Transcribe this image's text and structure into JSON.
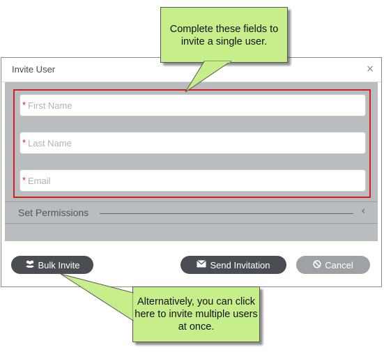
{
  "dialog": {
    "title": "Invite User",
    "close_glyph": "×",
    "fields": [
      {
        "required_mark": "*",
        "placeholder": "First Name",
        "value": ""
      },
      {
        "required_mark": "*",
        "placeholder": "Last Name",
        "value": ""
      },
      {
        "required_mark": "*",
        "placeholder": "Email",
        "value": ""
      }
    ],
    "permissions": {
      "label": "Set Permissions",
      "chevron": "‹"
    },
    "buttons": {
      "bulk_invite": {
        "label": "Bulk Invite",
        "icon": "users-icon"
      },
      "send_invitation": {
        "label": "Send Invitation",
        "icon": "envelope-icon"
      },
      "cancel": {
        "label": "Cancel",
        "icon": "ban-icon"
      }
    }
  },
  "callouts": {
    "top": "Complete these fields to invite a single user.",
    "bottom": "Alternatively, you can click here to invite multiple users at once."
  },
  "colors": {
    "callout_fill": "#c6ee8a",
    "highlight_border": "#d21f1f",
    "dark_button": "#4a4e52",
    "cancel_button": "#9ea2a5",
    "body_background": "#b9bdbf"
  }
}
